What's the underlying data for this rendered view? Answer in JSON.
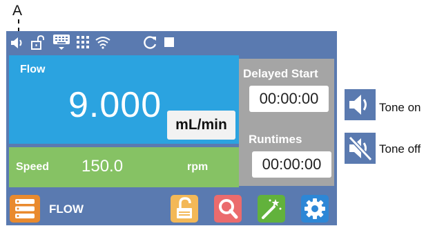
{
  "callout": {
    "label": "A"
  },
  "status_bar": {
    "icons": [
      "speaker-icon",
      "unlock-icon",
      "keyboard-icon",
      "grid-dots-icon",
      "wifi-icon",
      "refresh-icon",
      "stop-icon"
    ]
  },
  "flow": {
    "label": "Flow",
    "value": "9.000",
    "unit": "mL/min"
  },
  "speed": {
    "label": "Speed",
    "value": "150.0",
    "unit": "rpm"
  },
  "delayed_start": {
    "title": "Delayed Start",
    "time": "00:00:00"
  },
  "runtimes": {
    "title": "Runtimes",
    "time": "00:00:00"
  },
  "bottom_bar": {
    "mode_label": "FLOW",
    "buttons": [
      "menu-icon",
      "unlock-icon",
      "search-icon",
      "magic-wand-icon",
      "settings-icon"
    ]
  },
  "legend": [
    {
      "icon": "tone-on-icon",
      "label": "Tone on"
    },
    {
      "icon": "tone-off-icon",
      "label": "Tone off"
    }
  ],
  "colors": {
    "device_bg": "#5a7ab0",
    "flow_panel": "#2ba3e0",
    "speed_panel": "#86c264",
    "side_panel": "#a5a5a5",
    "menu_button": "#e98a2e",
    "lock_button": "#f3b857",
    "search_button": "#eb6b6d",
    "wand_button": "#62b23c",
    "settings_button": "#2d87d6"
  }
}
